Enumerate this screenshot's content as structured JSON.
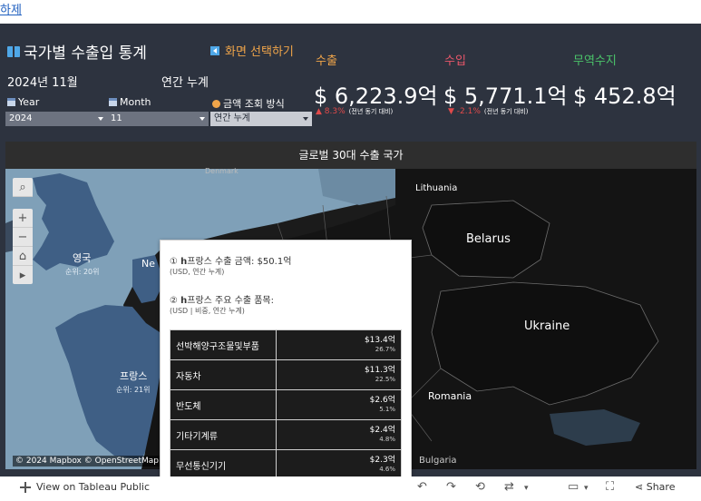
{
  "top_link": "하제",
  "header": {
    "title": "국가별 수출입 통계",
    "switch_label": "화면 선택하기",
    "period": "2024년 11월",
    "cumulative": "연간 누계"
  },
  "filters": {
    "year": {
      "label": "Year",
      "value": "2024"
    },
    "month": {
      "label": "Month",
      "value": "11"
    },
    "mode": {
      "label": "금액 조회 방식",
      "value": "연간 누계"
    }
  },
  "kpis": [
    {
      "label": "수출",
      "value": "$ 6,223.9억",
      "change": "▲ 8.3%",
      "change_note": "(전년 동기 대비)",
      "label_color": "#f0a54a"
    },
    {
      "label": "수입",
      "value": "$ 5,771.1억",
      "change": "▼ -2.1%",
      "change_note": "(전년 동기 대비)",
      "label_color": "#e8576a"
    },
    {
      "label": "무역수지",
      "value": "$ 452.8억",
      "label_color": "#4bc46a"
    }
  ],
  "map": {
    "heading": "글로벌 30대 수출 국가",
    "labels": {
      "denmark": "Denmark",
      "lithuania": "Lithuania",
      "belarus": "Belarus",
      "ukraine": "Ukraine",
      "romania": "Romania",
      "bulgaria": "Bulgaria",
      "uk": "영국",
      "uk_rank": "순위: 20위",
      "france": "프랑스",
      "france_rank": "순위: 21위",
      "ne": "Ne"
    },
    "copyright": "© 2024 Mapbox © OpenStreetMap"
  },
  "tooltip": {
    "export_line": "① 𝗵프랑스 수출 금액: $50.1억",
    "export_unit": "(USD, 연간 누계)",
    "items_line": "② 𝗵프랑스 주요 수출 품목:",
    "items_unit": "(USD | 비중, 연간 누계)",
    "items": [
      {
        "name": "선박해양구조물및부품",
        "value": "$13.4억",
        "share": "26.7%"
      },
      {
        "name": "자동차",
        "value": "$11.3억",
        "share": "22.5%"
      },
      {
        "name": "반도체",
        "value": "$2.6억",
        "share": "5.1%"
      },
      {
        "name": "기타기계류",
        "value": "$2.4억",
        "share": "4.8%"
      },
      {
        "name": "무선통신기기",
        "value": "$2.3억",
        "share": "4.6%"
      }
    ]
  },
  "footer": {
    "view_on": "View on Tableau Public",
    "share": "Share"
  },
  "colors": {
    "background": "#2d333f",
    "accent_blue": "#4fa8e8",
    "export_orange": "#f0a54a",
    "import_red": "#e8576a",
    "balance_green": "#4bc46a"
  }
}
